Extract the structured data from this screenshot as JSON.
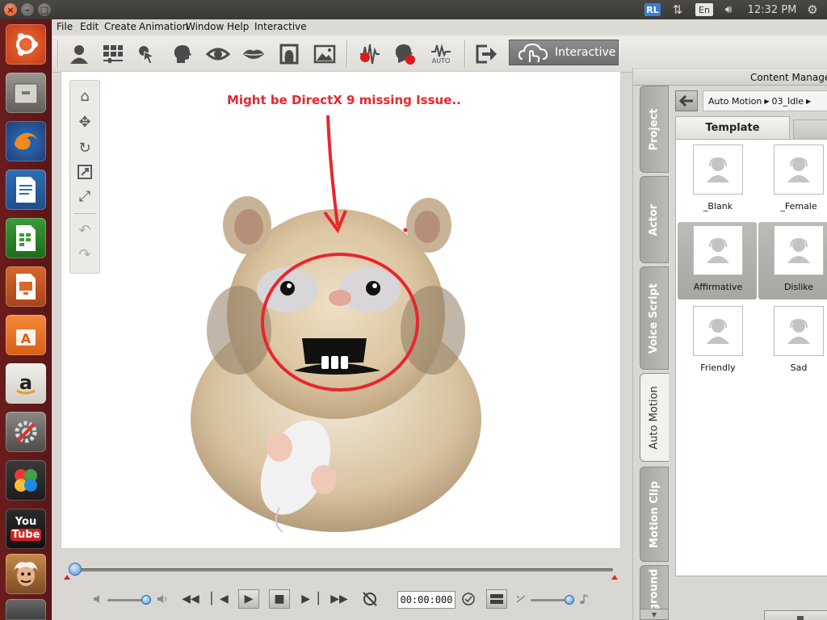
{
  "system": {
    "tray": {
      "rl": "RL",
      "lang": "En",
      "clock": "12:32 PM"
    }
  },
  "menu": [
    "File",
    "Edit",
    "Create",
    "Animation",
    "Window",
    "Help",
    "Interactive"
  ],
  "toolbar": {
    "interactive_label": "Interactive",
    "auto_label": "AUTO"
  },
  "viewport": {
    "annotation": "Might be DirectX 9 missing Issue..",
    "annotation_color": "#e8262e"
  },
  "timeline": {
    "time": "00:00:000",
    "progress": 0.0
  },
  "content_manager": {
    "title": "Content Manager",
    "side_tabs": [
      "Project",
      "Actor",
      "Voice Script",
      "Auto Motion",
      "Motion Clip",
      "Background"
    ],
    "active_tab": "Auto Motion",
    "breadcrumb": [
      "Auto Motion",
      "03_Idle"
    ],
    "template_tab": "Template",
    "items": [
      {
        "label": "_Blank",
        "selected": false
      },
      {
        "label": "_Female",
        "selected": false
      },
      {
        "label": "Affirmative",
        "selected": true
      },
      {
        "label": "Dislike",
        "selected": true
      },
      {
        "label": "Friendly",
        "selected": false
      },
      {
        "label": "Sad",
        "selected": false
      }
    ]
  },
  "launcher": {
    "youtube_top": "You",
    "youtube_bottom": "Tube"
  }
}
